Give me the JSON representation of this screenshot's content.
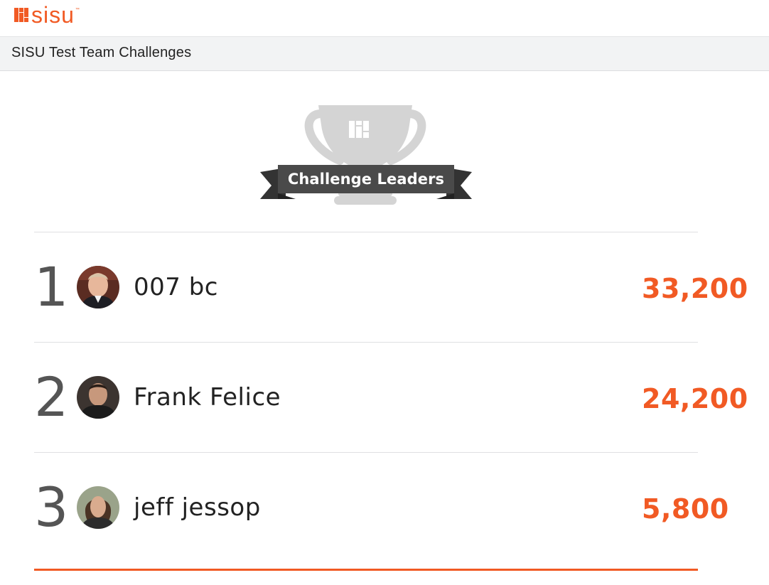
{
  "brand": {
    "logo_text": "sisu",
    "trademark": "™",
    "accent_color": "#f15a24"
  },
  "header": {
    "title": "SISU Test Team Challenges"
  },
  "banner": {
    "label": "Challenge Leaders",
    "trophy_icon": "trophy-icon"
  },
  "leaders": [
    {
      "rank": "1",
      "name": "007 bc",
      "score": "33,200",
      "avatar": "user-avatar"
    },
    {
      "rank": "2",
      "name": "Frank Felice",
      "score": "24,200",
      "avatar": "user-avatar"
    },
    {
      "rank": "3",
      "name": "jeff jessop",
      "score": "5,800",
      "avatar": "user-avatar"
    }
  ]
}
